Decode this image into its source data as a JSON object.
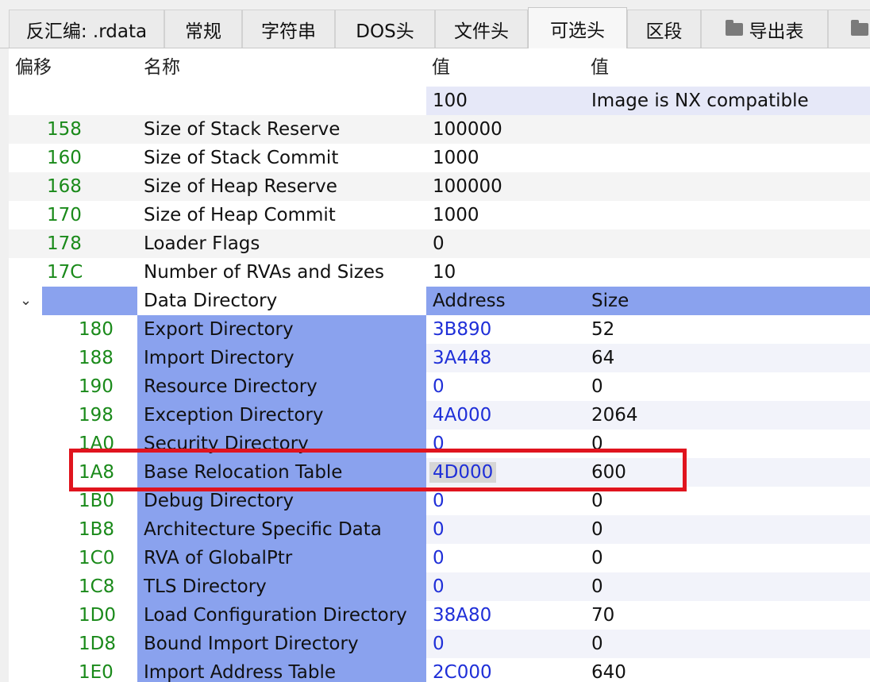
{
  "tabs": [
    {
      "label": "反汇编: .rdata",
      "folder": false
    },
    {
      "label": "常规",
      "folder": false
    },
    {
      "label": "字符串",
      "folder": false
    },
    {
      "label": "DOS头",
      "folder": false
    },
    {
      "label": "文件头",
      "folder": false
    },
    {
      "label": "可选头",
      "folder": false,
      "active": true
    },
    {
      "label": "区段",
      "folder": false
    },
    {
      "label": "导出表",
      "folder": true
    },
    {
      "label": "",
      "folder": true
    }
  ],
  "columns": [
    "偏移",
    "名称",
    "值",
    "值"
  ],
  "characteristics_row": {
    "value": "100",
    "description": "Image is NX compatible"
  },
  "rows": [
    {
      "offset": "158",
      "name": "Size of Stack Reserve",
      "value": "100000"
    },
    {
      "offset": "160",
      "name": "Size of Stack Commit",
      "value": "1000"
    },
    {
      "offset": "168",
      "name": "Size of Heap Reserve",
      "value": "100000"
    },
    {
      "offset": "170",
      "name": "Size of Heap Commit",
      "value": "1000"
    },
    {
      "offset": "178",
      "name": "Loader Flags",
      "value": "0"
    },
    {
      "offset": "17C",
      "name": "Number of RVAs and Sizes",
      "value": "10"
    }
  ],
  "data_directory": {
    "label": "Data Directory",
    "col_address": "Address",
    "col_size": "Size",
    "expand_icon": "chevron-down-icon",
    "entries": [
      {
        "offset": "180",
        "name": "Export Directory",
        "address": "3B890",
        "size": "52"
      },
      {
        "offset": "188",
        "name": "Import Directory",
        "address": "3A448",
        "size": "64"
      },
      {
        "offset": "190",
        "name": "Resource Directory",
        "address": "0",
        "size": "0"
      },
      {
        "offset": "198",
        "name": "Exception Directory",
        "address": "4A000",
        "size": "2064"
      },
      {
        "offset": "1A0",
        "name": "Security Directory",
        "address": "0",
        "size": "0"
      },
      {
        "offset": "1A8",
        "name": "Base Relocation Table",
        "address": "4D000",
        "size": "600",
        "highlighted": true
      },
      {
        "offset": "1B0",
        "name": "Debug Directory",
        "address": "0",
        "size": "0"
      },
      {
        "offset": "1B8",
        "name": "Architecture Specific Data",
        "address": "0",
        "size": "0"
      },
      {
        "offset": "1C0",
        "name": "RVA of GlobalPtr",
        "address": "0",
        "size": "0"
      },
      {
        "offset": "1C8",
        "name": "TLS Directory",
        "address": "0",
        "size": "0"
      },
      {
        "offset": "1D0",
        "name": "Load Configuration Directory",
        "address": "38A80",
        "size": "70"
      },
      {
        "offset": "1D8",
        "name": "Bound Import Directory",
        "address": "0",
        "size": "0"
      },
      {
        "offset": "1E0",
        "name": "Import Address Table",
        "address": "2C000",
        "size": "640"
      }
    ]
  },
  "colors": {
    "offset": "#1a8a1a",
    "address": "#1f2fd8",
    "directory_bg": "#8aa2ee",
    "annotation": "#e0141e"
  }
}
